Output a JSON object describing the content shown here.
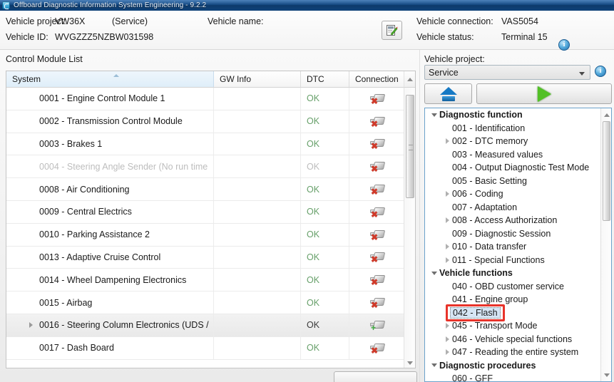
{
  "window": {
    "title": "Offboard Diagnostic Information System Engineering - 9.2.2",
    "icon": "app-icon"
  },
  "header": {
    "vehicle_project_label": "Vehicle project:",
    "vehicle_project_value": "VW36X",
    "vehicle_project_mode": "(Service)",
    "vehicle_name_label": "Vehicle name:",
    "vehicle_name_value": "",
    "vehicle_id_label": "Vehicle ID:",
    "vehicle_id_value": "WVGZZZ5NZBW031598",
    "vehicle_connection_label": "Vehicle connection:",
    "vehicle_connection_value": "VAS5054",
    "vehicle_status_label": "Vehicle status:",
    "vehicle_status_value": "Terminal 15",
    "info_icon": "i",
    "doc_button_icon": "document-edit-icon"
  },
  "control_module_list": {
    "title": "Control Module List",
    "columns": [
      "System",
      "GW Info",
      "DTC",
      "Connection"
    ],
    "rows": [
      {
        "system": "0001 - Engine Control Module 1",
        "gw": "",
        "dtc": "OK",
        "conn": "disconnected",
        "expandable": false,
        "dim": false,
        "selected": false
      },
      {
        "system": "0002 - Transmission Control Module",
        "gw": "",
        "dtc": "OK",
        "conn": "disconnected",
        "expandable": false,
        "dim": false,
        "selected": false
      },
      {
        "system": "0003 - Brakes 1",
        "gw": "",
        "dtc": "OK",
        "conn": "disconnected",
        "expandable": false,
        "dim": false,
        "selected": false
      },
      {
        "system": "0004 - Steering Angle Sender  (No run time",
        "gw": "",
        "dtc": "OK",
        "conn": "disconnected",
        "expandable": false,
        "dim": true,
        "selected": false
      },
      {
        "system": "0008 - Air Conditioning",
        "gw": "",
        "dtc": "OK",
        "conn": "disconnected",
        "expandable": false,
        "dim": false,
        "selected": false
      },
      {
        "system": "0009 - Central Electrics",
        "gw": "",
        "dtc": "OK",
        "conn": "disconnected",
        "expandable": false,
        "dim": false,
        "selected": false
      },
      {
        "system": "0010 - Parking Assistance 2",
        "gw": "",
        "dtc": "OK",
        "conn": "disconnected",
        "expandable": false,
        "dim": false,
        "selected": false
      },
      {
        "system": "0013 - Adaptive Cruise Control",
        "gw": "",
        "dtc": "OK",
        "conn": "disconnected",
        "expandable": false,
        "dim": false,
        "selected": false
      },
      {
        "system": "0014 - Wheel Dampening Electronics",
        "gw": "",
        "dtc": "OK",
        "conn": "disconnected",
        "expandable": false,
        "dim": false,
        "selected": false
      },
      {
        "system": "0015 - Airbag",
        "gw": "",
        "dtc": "OK",
        "conn": "disconnected",
        "expandable": false,
        "dim": false,
        "selected": false
      },
      {
        "system": "0016 - Steering Column Electronics  (UDS /",
        "gw": "",
        "dtc": "OK",
        "conn": "connected",
        "expandable": true,
        "dim": false,
        "selected": true
      },
      {
        "system": "0017 - Dash Board",
        "gw": "",
        "dtc": "OK",
        "conn": "disconnected",
        "expandable": false,
        "dim": false,
        "selected": false
      }
    ]
  },
  "right_panel": {
    "vehicle_project_label": "Vehicle project:",
    "selected_project": "Service",
    "info_icon": "i",
    "eject_button_icon": "eject-icon",
    "run_button_icon": "play-icon",
    "tree": [
      {
        "label": "Diagnostic function",
        "level": 0,
        "arrow": "open",
        "group": true,
        "selected": false
      },
      {
        "label": "001 - Identification",
        "level": 1,
        "arrow": "none",
        "group": false,
        "selected": false
      },
      {
        "label": "002 - DTC memory",
        "level": 1,
        "arrow": "closed",
        "group": false,
        "selected": false
      },
      {
        "label": "003 - Measured values",
        "level": 1,
        "arrow": "none",
        "group": false,
        "selected": false
      },
      {
        "label": "004 - Output Diagnostic Test Mode",
        "level": 1,
        "arrow": "none",
        "group": false,
        "selected": false
      },
      {
        "label": "005 - Basic Setting",
        "level": 1,
        "arrow": "none",
        "group": false,
        "selected": false
      },
      {
        "label": "006 - Coding",
        "level": 1,
        "arrow": "closed",
        "group": false,
        "selected": false
      },
      {
        "label": "007 - Adaptation",
        "level": 1,
        "arrow": "none",
        "group": false,
        "selected": false
      },
      {
        "label": "008 - Access Authorization",
        "level": 1,
        "arrow": "closed",
        "group": false,
        "selected": false
      },
      {
        "label": "009 - Diagnostic Session",
        "level": 1,
        "arrow": "none",
        "group": false,
        "selected": false
      },
      {
        "label": "010 - Data transfer",
        "level": 1,
        "arrow": "closed",
        "group": false,
        "selected": false
      },
      {
        "label": "011 - Special Functions",
        "level": 1,
        "arrow": "closed",
        "group": false,
        "selected": false
      },
      {
        "label": "Vehicle functions",
        "level": 0,
        "arrow": "open",
        "group": true,
        "selected": false
      },
      {
        "label": "040 - OBD customer service",
        "level": 1,
        "arrow": "none",
        "group": false,
        "selected": false
      },
      {
        "label": "041 - Engine group",
        "level": 1,
        "arrow": "none",
        "group": false,
        "selected": false
      },
      {
        "label": "042 - Flash",
        "level": 1,
        "arrow": "none",
        "group": false,
        "selected": true
      },
      {
        "label": "045 - Transport Mode",
        "level": 1,
        "arrow": "closed",
        "group": false,
        "selected": false
      },
      {
        "label": "046 - Vehicle special functions",
        "level": 1,
        "arrow": "closed",
        "group": false,
        "selected": false
      },
      {
        "label": "047 - Reading the entire system",
        "level": 1,
        "arrow": "closed",
        "group": false,
        "selected": false
      },
      {
        "label": "Diagnostic procedures",
        "level": 0,
        "arrow": "open",
        "group": true,
        "selected": false
      },
      {
        "label": "060 - GFF",
        "level": 1,
        "arrow": "none",
        "group": false,
        "selected": false
      }
    ]
  },
  "annotation": {
    "highlight_target": "042 - Flash",
    "color": "#e8332a"
  }
}
